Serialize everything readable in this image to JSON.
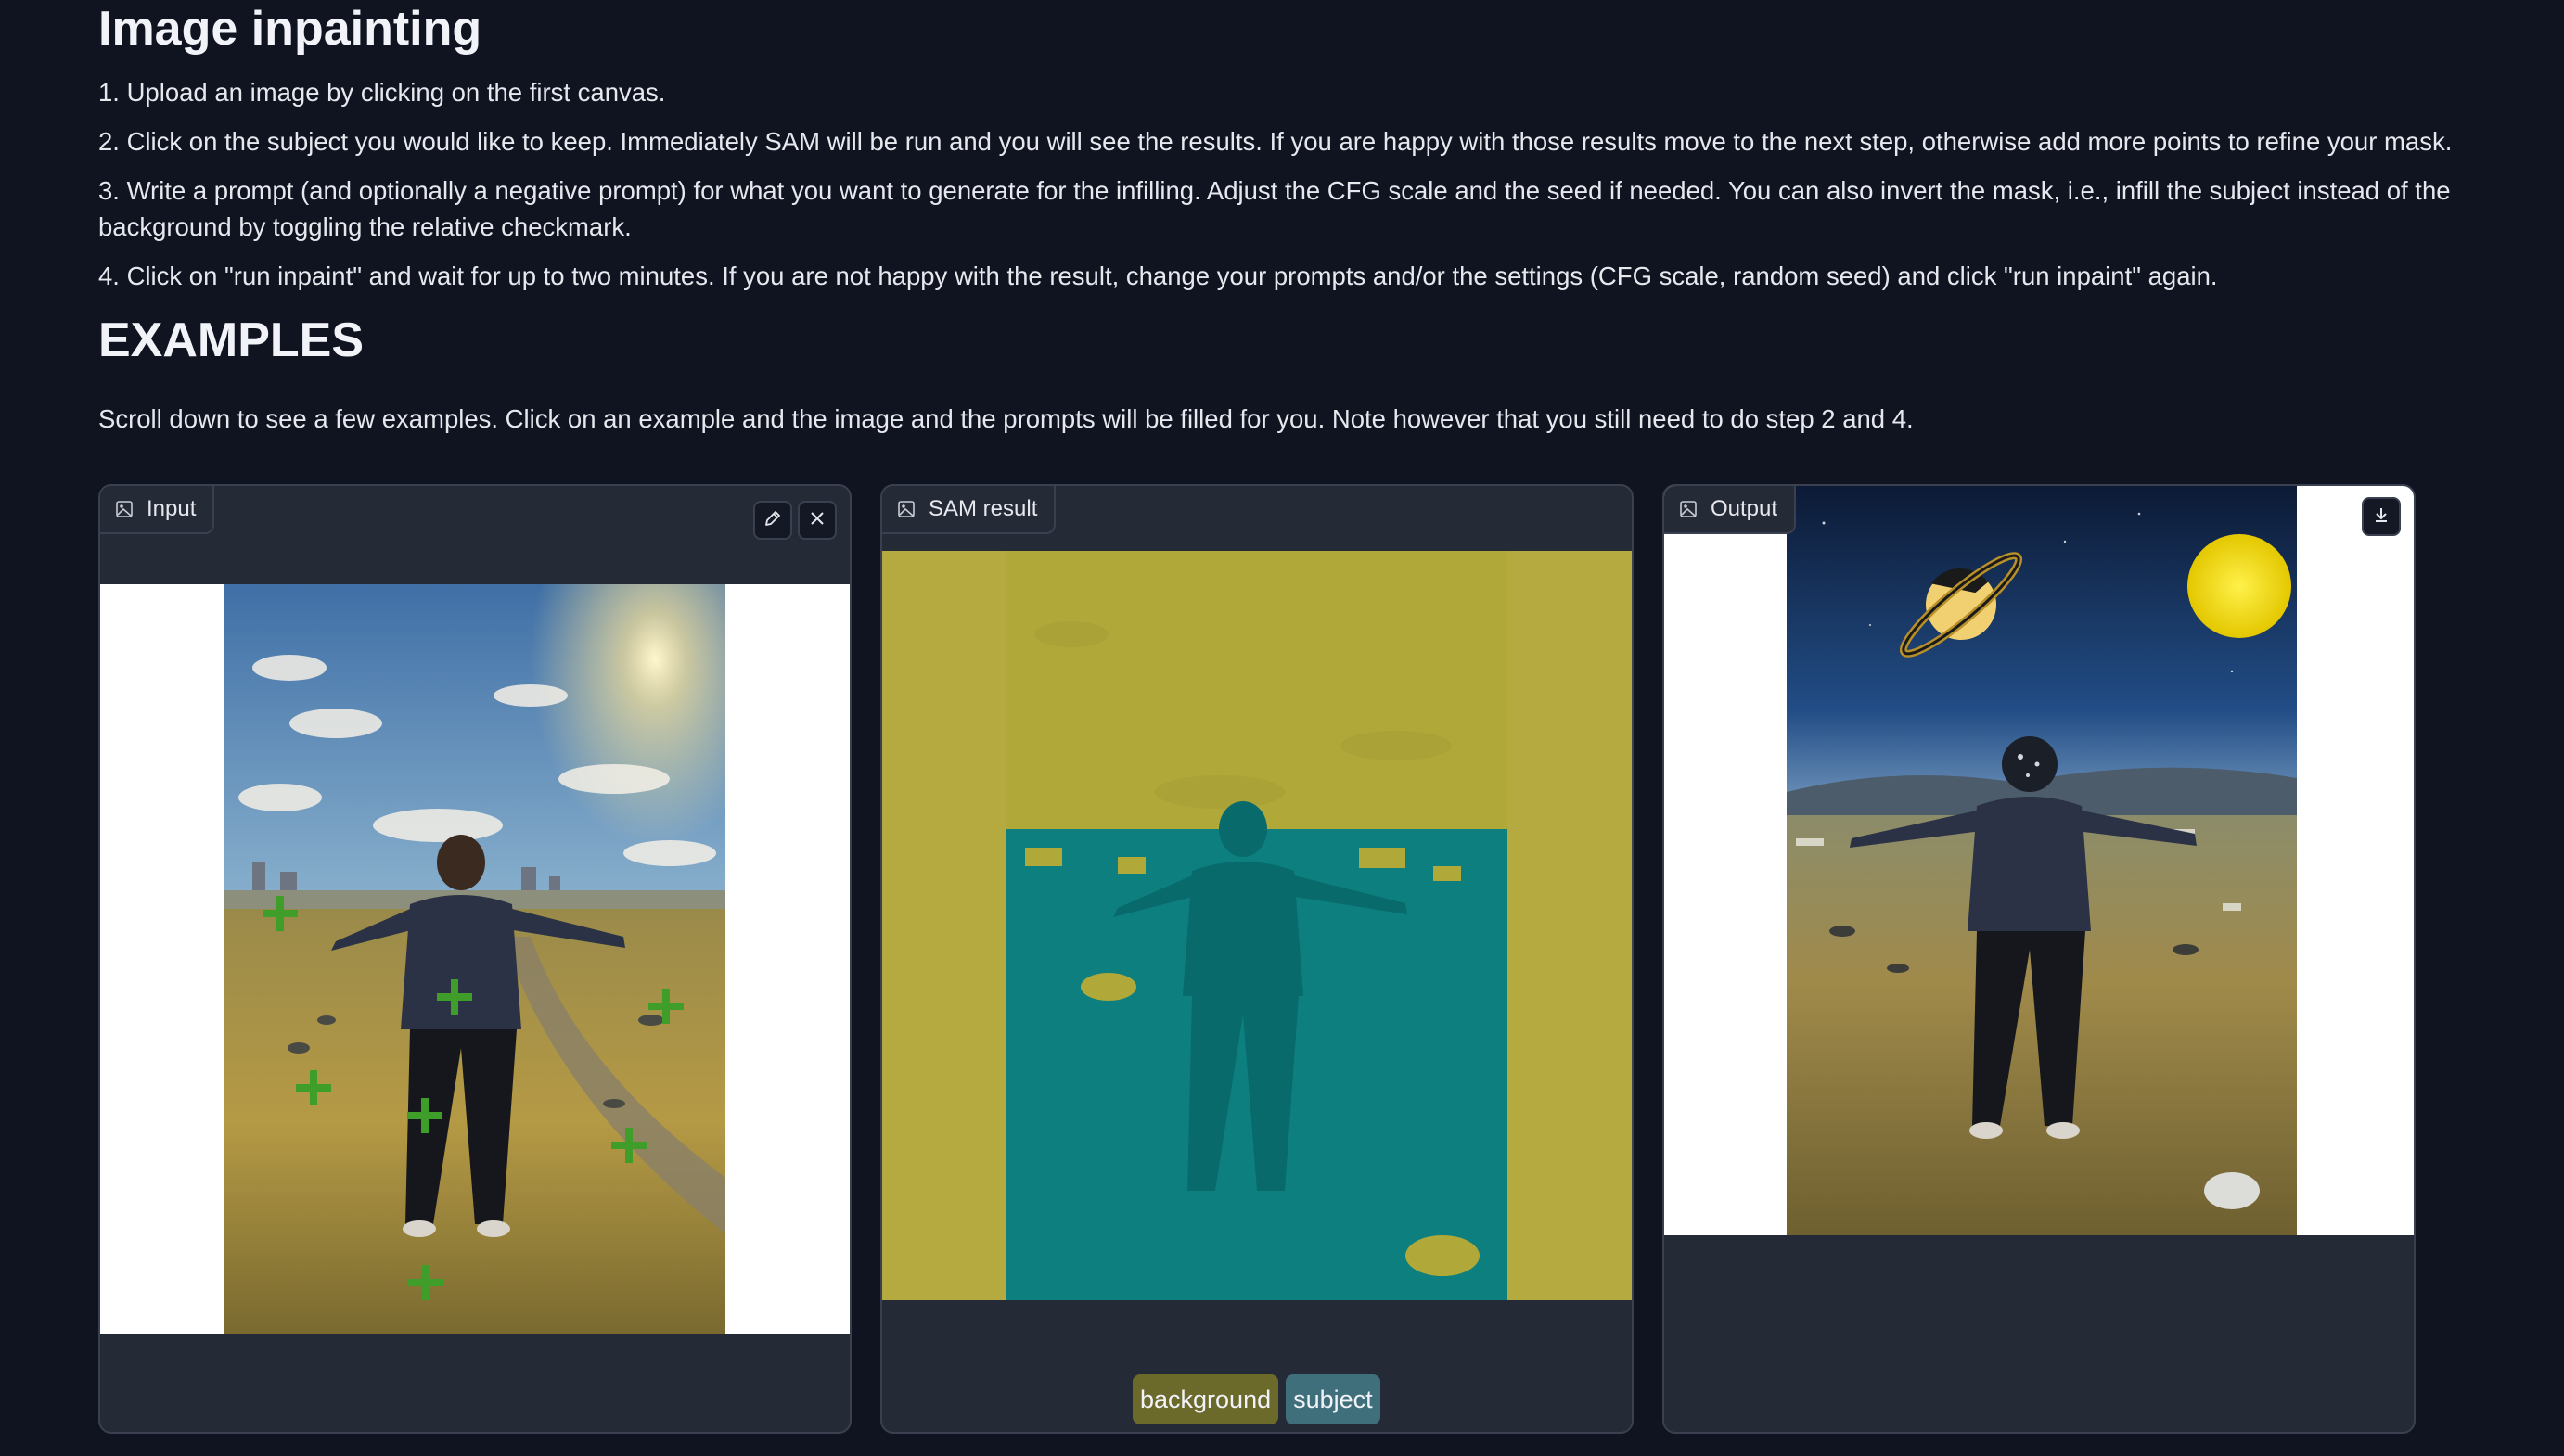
{
  "header": {
    "title": "Image inpainting",
    "steps": [
      "1. Upload an image by clicking on the first canvas.",
      "2. Click on the subject you would like to keep. Immediately SAM will be run and you will see the results. If you are happy with those results move to the next step, otherwise add more points to refine your mask.",
      "3. Write a prompt (and optionally a negative prompt) for what you want to generate for the infilling. Adjust the CFG scale and the seed if needed. You can also invert the mask, i.e., infill the subject instead of the background by toggling the relative checkmark.",
      "4. Click on \"run inpaint\" and wait for up to two minutes. If you are not happy with the result, change your prompts and/or the settings (CFG scale, random seed) and click \"run inpaint\" again."
    ]
  },
  "examples": {
    "heading": "EXAMPLES",
    "note": "Scroll down to see a few examples. Click on an example and the image and the prompts will be filled for you. Note however that you still need to do step 2 and 4."
  },
  "panels": {
    "input": {
      "label": "Input",
      "edit_icon": "pencil-icon",
      "close_icon": "close-icon"
    },
    "sam": {
      "label": "SAM result",
      "legend": [
        "background",
        "subject"
      ]
    },
    "output": {
      "label": "Output",
      "download_icon": "download-icon"
    }
  },
  "colors": {
    "background_chip": "#6b6a2a",
    "subject_chip": "#3f6f7a",
    "mask_background": "#b5aa3f",
    "mask_subject": "#0e7f7f",
    "point_marker": "#3f9d2a"
  }
}
